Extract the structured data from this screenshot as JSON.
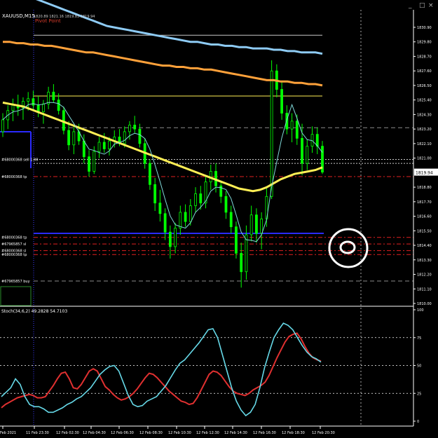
{
  "window": {
    "symbol_title": "XAUUSD,M15",
    "ohlc": "1820.89 1821.16 1819.83 1819.94",
    "pivot_label": "Pivot Point",
    "controls": [
      "_",
      "□",
      "×"
    ]
  },
  "colors": {
    "background": "#000000",
    "axis": "#ffffff",
    "up_candle": "#00ff00",
    "down_candle": "#000000",
    "fast_ma": "#7fd7d7",
    "ma_yellow": "#ffef55",
    "ma_orange": "#ffa13a",
    "ma_blue": "#8ecbf4",
    "stoch_main": "#66d9e8",
    "stoch_signal": "#e03030",
    "order_red": "#e02020",
    "grid_gray": "#8a8a8a",
    "price_tag": "#d40000",
    "circle": "#ffffff"
  },
  "chart_data": [
    {
      "type": "candlestick",
      "title": "XAUUSD,M15",
      "ylim": [
        1810.0,
        1831.8
      ],
      "y_ticks": [
        "1830.90",
        "1829.80",
        "1828.70",
        "1827.60",
        "1826.50",
        "1825.40",
        "1824.30",
        "1823.20",
        "1822.10",
        "1821.00",
        "1819.94",
        "1818.80",
        "1817.70",
        "1816.60",
        "1815.50",
        "1814.40",
        "1813.30",
        "1812.20",
        "1811.10",
        "1810.00"
      ],
      "current_price": "1819.94",
      "x_ticks": [
        "11 Feb 2021",
        "11 Feb 23:30",
        "12 Feb 02:30",
        "12 Feb 04:30",
        "12 Feb 06:30",
        "12 Feb 08:30",
        "12 Feb 10:30",
        "12 Feb 12:30",
        "12 Feb 14:30",
        "12 Feb 16:30",
        "12 Feb 18:30",
        "12 Feb 20:30"
      ],
      "candles": [
        [
          1823.0,
          1824.4,
          1822.6,
          1823.9
        ],
        [
          1823.9,
          1825.0,
          1823.2,
          1824.6
        ],
        [
          1824.6,
          1825.5,
          1823.8,
          1825.0
        ],
        [
          1825.0,
          1825.8,
          1824.2,
          1824.8
        ],
        [
          1824.8,
          1825.6,
          1823.9,
          1825.3
        ],
        [
          1825.3,
          1826.0,
          1824.6,
          1825.5
        ],
        [
          1825.5,
          1826.1,
          1824.7,
          1825.0
        ],
        [
          1825.0,
          1825.7,
          1824.1,
          1824.5
        ],
        [
          1824.5,
          1825.4,
          1823.6,
          1825.1
        ],
        [
          1825.1,
          1826.4,
          1824.7,
          1826.0
        ],
        [
          1826.0,
          1826.6,
          1825.2,
          1825.4
        ],
        [
          1825.4,
          1825.9,
          1824.3,
          1824.6
        ],
        [
          1824.6,
          1824.9,
          1822.8,
          1823.1
        ],
        [
          1823.1,
          1823.8,
          1821.6,
          1822.0
        ],
        [
          1822.0,
          1823.4,
          1821.3,
          1823.0
        ],
        [
          1823.0,
          1823.6,
          1822.0,
          1822.3
        ],
        [
          1822.3,
          1822.8,
          1820.6,
          1821.1
        ],
        [
          1821.1,
          1821.6,
          1819.6,
          1820.0
        ],
        [
          1820.0,
          1821.9,
          1819.8,
          1821.5
        ],
        [
          1821.5,
          1822.6,
          1821.0,
          1822.2
        ],
        [
          1822.2,
          1822.9,
          1821.4,
          1821.7
        ],
        [
          1821.7,
          1822.6,
          1821.2,
          1822.3
        ],
        [
          1822.3,
          1823.1,
          1821.8,
          1822.6
        ],
        [
          1822.6,
          1823.2,
          1821.9,
          1822.1
        ],
        [
          1822.1,
          1823.4,
          1821.8,
          1823.0
        ],
        [
          1823.0,
          1823.8,
          1822.4,
          1823.5
        ],
        [
          1823.5,
          1824.2,
          1822.9,
          1823.2
        ],
        [
          1823.2,
          1823.6,
          1821.8,
          1822.1
        ],
        [
          1822.1,
          1822.5,
          1820.2,
          1820.6
        ],
        [
          1820.6,
          1820.9,
          1818.6,
          1819.0
        ],
        [
          1819.0,
          1819.5,
          1817.0,
          1817.6
        ],
        [
          1817.6,
          1818.6,
          1816.2,
          1816.8
        ],
        [
          1816.8,
          1817.2,
          1814.8,
          1815.4
        ],
        [
          1815.4,
          1815.9,
          1813.4,
          1814.3
        ],
        [
          1814.3,
          1816.1,
          1813.8,
          1815.7
        ],
        [
          1815.7,
          1817.4,
          1815.2,
          1816.9
        ],
        [
          1816.9,
          1817.5,
          1815.8,
          1816.2
        ],
        [
          1816.2,
          1817.9,
          1815.9,
          1817.4
        ],
        [
          1817.4,
          1818.8,
          1816.9,
          1818.3
        ],
        [
          1818.3,
          1818.9,
          1817.1,
          1817.6
        ],
        [
          1817.6,
          1819.6,
          1817.2,
          1819.2
        ],
        [
          1819.2,
          1820.5,
          1818.6,
          1820.0
        ],
        [
          1820.0,
          1820.6,
          1818.4,
          1818.9
        ],
        [
          1818.9,
          1819.3,
          1817.6,
          1818.1
        ],
        [
          1818.1,
          1818.5,
          1816.4,
          1816.9
        ],
        [
          1816.9,
          1817.4,
          1815.3,
          1815.8
        ],
        [
          1815.8,
          1816.2,
          1813.4,
          1813.8
        ],
        [
          1813.8,
          1814.6,
          1811.2,
          1812.4
        ],
        [
          1812.4,
          1815.9,
          1811.8,
          1815.2
        ],
        [
          1815.2,
          1817.4,
          1814.7,
          1816.7
        ],
        [
          1816.7,
          1817.2,
          1814.6,
          1815.3
        ],
        [
          1815.3,
          1816.9,
          1814.1,
          1816.4
        ],
        [
          1816.4,
          1818.7,
          1815.8,
          1818.1
        ],
        [
          1818.1,
          1828.4,
          1817.9,
          1827.6
        ],
        [
          1827.6,
          1828.1,
          1825.6,
          1826.2
        ],
        [
          1826.2,
          1826.8,
          1823.9,
          1824.4
        ],
        [
          1824.4,
          1825.0,
          1822.8,
          1823.2
        ],
        [
          1823.2,
          1824.4,
          1822.2,
          1823.8
        ],
        [
          1823.8,
          1824.3,
          1822.0,
          1822.5
        ],
        [
          1822.5,
          1823.6,
          1819.7,
          1820.6
        ],
        [
          1820.6,
          1822.4,
          1820.1,
          1821.9
        ],
        [
          1821.9,
          1823.4,
          1821.4,
          1822.8
        ],
        [
          1822.8,
          1823.3,
          1821.3,
          1821.9
        ],
        [
          1821.9,
          1822.3,
          1819.8,
          1819.94
        ]
      ],
      "moving_averages": [
        {
          "values": [
            1825.2,
            1825.1,
            1825.0,
            1824.9,
            1824.7,
            1824.5,
            1824.3,
            1824.1,
            1823.9,
            1823.7,
            1823.5,
            1823.3,
            1823.1,
            1822.9,
            1822.7,
            1822.5,
            1822.3,
            1822.1,
            1821.9,
            1821.7,
            1821.5,
            1821.3,
            1821.1,
            1820.9,
            1820.7,
            1820.5,
            1820.3,
            1820.1,
            1819.9,
            1819.7,
            1819.5,
            1819.3,
            1819.1,
            1818.9,
            1818.7,
            1818.6,
            1818.5,
            1818.6,
            1818.8,
            1819.1,
            1819.4,
            1819.6,
            1819.8,
            1819.9,
            1820.0,
            1820.1,
            1820.3
          ]
        },
        {
          "values": [
            1829.8,
            1829.8,
            1829.7,
            1829.7,
            1829.6,
            1829.6,
            1829.5,
            1829.5,
            1829.4,
            1829.3,
            1829.2,
            1829.1,
            1829.0,
            1829.0,
            1828.9,
            1828.8,
            1828.7,
            1828.6,
            1828.5,
            1828.4,
            1828.3,
            1828.2,
            1828.1,
            1828.0,
            1828.0,
            1827.9,
            1827.9,
            1827.8,
            1827.8,
            1827.7,
            1827.7,
            1827.6,
            1827.5,
            1827.4,
            1827.3,
            1827.2,
            1827.1,
            1827.0,
            1826.9,
            1826.9,
            1826.8,
            1826.8,
            1826.7,
            1826.7,
            1826.6,
            1826.6,
            1826.5
          ]
        },
        {
          "values": [
            1834.0,
            1833.8,
            1833.6,
            1833.4,
            1833.2,
            1833.0,
            1832.8,
            1832.6,
            1832.4,
            1832.2,
            1832.0,
            1831.8,
            1831.6,
            1831.4,
            1831.2,
            1831.0,
            1830.9,
            1830.8,
            1830.7,
            1830.6,
            1830.5,
            1830.4,
            1830.3,
            1830.2,
            1830.1,
            1830.0,
            1829.9,
            1829.8,
            1829.8,
            1829.7,
            1829.6,
            1829.6,
            1829.5,
            1829.5,
            1829.4,
            1829.4,
            1829.3,
            1829.3,
            1829.3,
            1829.2,
            1829.2,
            1829.1,
            1829.1,
            1829.0,
            1829.0,
            1829.0,
            1828.9
          ]
        }
      ],
      "horizontal_levels": [
        {
          "price": 1830.3,
          "label": ""
        },
        {
          "price": 1825.7,
          "label": ""
        },
        {
          "price": 1823.3,
          "label": ""
        },
        {
          "price": 1820.9,
          "label": "#68000368 sell 1.00"
        },
        {
          "price": 1820.6,
          "label": ""
        },
        {
          "price": 1819.6,
          "label": "#68000368 tp"
        },
        {
          "price": 1815.0,
          "label": "#68000368 tp"
        },
        {
          "price": 1814.5,
          "label": "#67965857 sl"
        },
        {
          "price": 1814.0,
          "label": "#68000368 sl"
        },
        {
          "price": 1813.7,
          "label": "#68000368 tp"
        },
        {
          "price": 1811.7,
          "label": "#67965857 buy"
        }
      ]
    },
    {
      "type": "line",
      "title": "Stoch(34,6,2) 49.2828 54.7103",
      "ylim": [
        0,
        100
      ],
      "y_ticks": [
        "100",
        "75",
        "50",
        "25",
        "0"
      ],
      "series": [
        {
          "values": [
            12,
            15,
            17,
            19,
            21,
            22,
            23,
            24,
            23,
            21,
            21,
            22,
            27,
            32,
            38,
            43,
            44,
            38,
            30,
            29,
            33,
            39,
            45,
            47,
            45,
            38,
            31,
            28,
            24,
            21,
            19,
            20,
            22,
            25,
            29,
            34,
            39,
            43,
            42,
            39,
            35,
            31,
            27,
            24,
            21,
            18,
            17,
            15,
            16,
            21,
            28,
            35,
            42,
            45,
            44,
            41,
            36,
            31,
            27,
            25,
            24,
            23,
            25,
            28,
            30,
            32,
            35,
            41,
            49,
            57,
            64,
            71,
            76,
            78,
            79,
            74,
            67,
            61,
            57,
            55,
            54
          ]
        },
        {
          "values": [
            22,
            26,
            30,
            38,
            33,
            22,
            15,
            13,
            13,
            11,
            8,
            8,
            10,
            12,
            15,
            17,
            20,
            22,
            26,
            30,
            36,
            42,
            46,
            49,
            50,
            45,
            34,
            23,
            15,
            13,
            14,
            18,
            20,
            22,
            27,
            32,
            39,
            46,
            52,
            55,
            60,
            65,
            70,
            76,
            82,
            83,
            75,
            60,
            45,
            30,
            18,
            10,
            5,
            8,
            15,
            30,
            48,
            62,
            75,
            82,
            88,
            86,
            82,
            75,
            68,
            62,
            58,
            56,
            53
          ]
        }
      ]
    }
  ]
}
